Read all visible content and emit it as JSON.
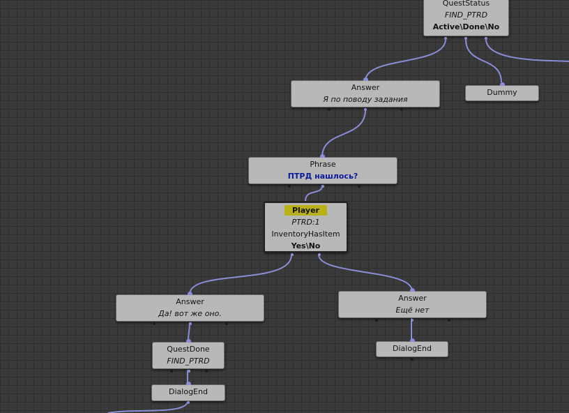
{
  "colors": {
    "canvas": "#3a3a3a",
    "grid": "#2e2e2e",
    "node": "#b8b8b8",
    "link": "#8a8ed8",
    "highlight": "#b8b014",
    "phrase_text": "#0a1a9a"
  },
  "nodes": {
    "quest_status": {
      "title": "QuestStatus",
      "quest": "FIND_PTRD",
      "outcomes": "Active\\Done\\No"
    },
    "answer_about_task": {
      "title": "Answer",
      "text": "Я по поводу задания"
    },
    "dummy": {
      "title": "Dummy"
    },
    "phrase": {
      "title": "Phrase",
      "text": "ПТРД нашлось?"
    },
    "player_check": {
      "speaker": "Player",
      "param": "PTRD:1",
      "condition": "InventoryHasItem",
      "outcomes": "Yes\\No"
    },
    "answer_yes": {
      "title": "Answer",
      "text": "Да! вот же оно."
    },
    "answer_no": {
      "title": "Answer",
      "text": "Ещё нет"
    },
    "quest_done": {
      "title": "QuestDone",
      "quest": "FIND_PTRD"
    },
    "dialog_end_left": {
      "title": "DialogEnd"
    },
    "dialog_end_right": {
      "title": "DialogEnd"
    }
  }
}
